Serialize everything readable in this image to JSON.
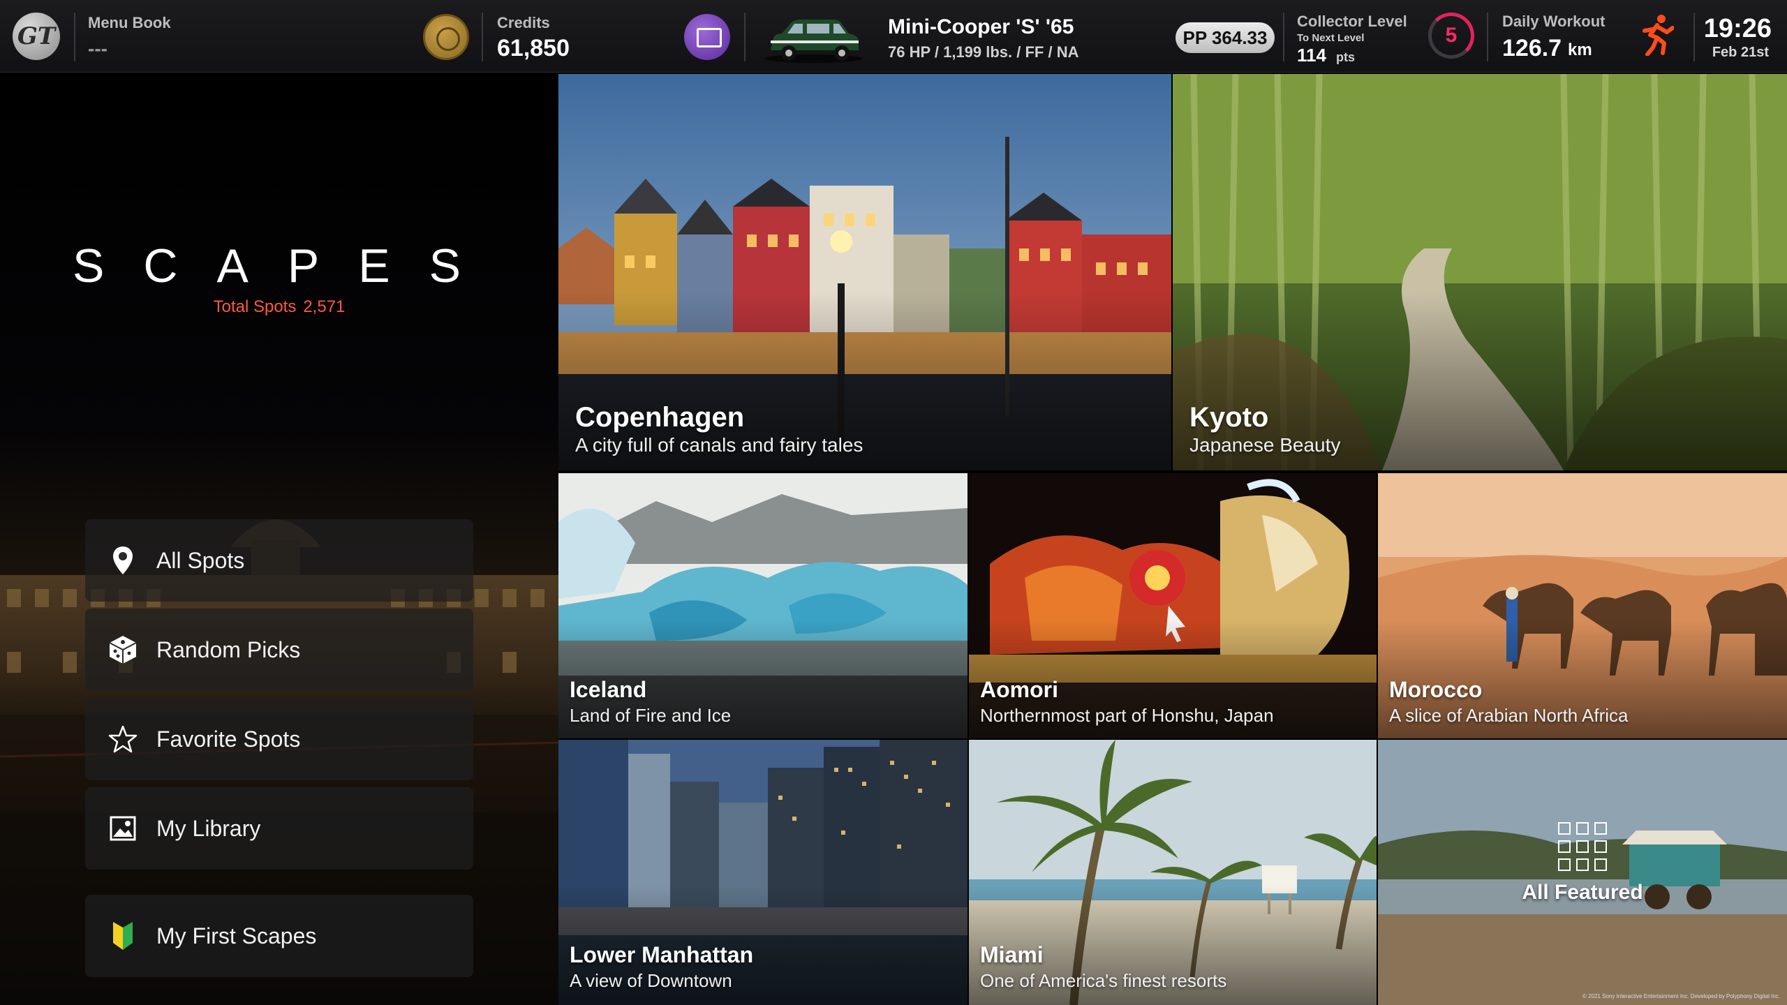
{
  "topbar": {
    "menu_book_label": "Menu Book",
    "menu_book_value": "---",
    "credits_label": "Credits",
    "credits_value": "61,850",
    "car_name": "Mini-Cooper 'S' '65",
    "car_specs": "76 HP / 1,199 lbs. / FF / NA",
    "pp_value": "PP 364.33",
    "collector_label": "Collector Level",
    "collector_next": "To Next Level",
    "collector_pts": "114",
    "collector_pts_unit": "pts",
    "collector_level": "5",
    "workout_label": "Daily Workout",
    "workout_value": "126.7",
    "workout_unit": "km",
    "clock": "19:26",
    "date": "Feb 21st"
  },
  "left": {
    "title": "SCAPES",
    "total_label": "Total Spots",
    "total_value": "2,571",
    "menu": [
      {
        "label": "All Spots",
        "icon": "map-pin-icon"
      },
      {
        "label": "Random Picks",
        "icon": "dice-icon"
      },
      {
        "label": "Favorite Spots",
        "icon": "star-icon"
      },
      {
        "label": "My Library",
        "icon": "image-icon"
      },
      {
        "label": "My First Scapes",
        "icon": "beginner-leaf-icon"
      }
    ]
  },
  "tiles": [
    {
      "title": "Copenhagen",
      "subtitle": "A city full of canals and fairy tales"
    },
    {
      "title": "Kyoto",
      "subtitle": "Japanese Beauty"
    },
    {
      "title": "Iceland",
      "subtitle": "Land of Fire and Ice"
    },
    {
      "title": "Aomori",
      "subtitle": "Northernmost part of Honshu, Japan"
    },
    {
      "title": "Morocco",
      "subtitle": "A slice of Arabian North Africa"
    },
    {
      "title": "Lower Manhattan",
      "subtitle": "A view of Downtown"
    },
    {
      "title": "Miami",
      "subtitle": "One of America's finest resorts"
    },
    {
      "title": "All Featured",
      "subtitle": ""
    }
  ],
  "copyright": "© 2021 Sony Interactive Entertainment Inc. Developed by Polyphony Digital Inc.",
  "colors": {
    "accent": "#ff5a3c",
    "level": "#ff2a6a",
    "runner": "#ff4d1a"
  }
}
